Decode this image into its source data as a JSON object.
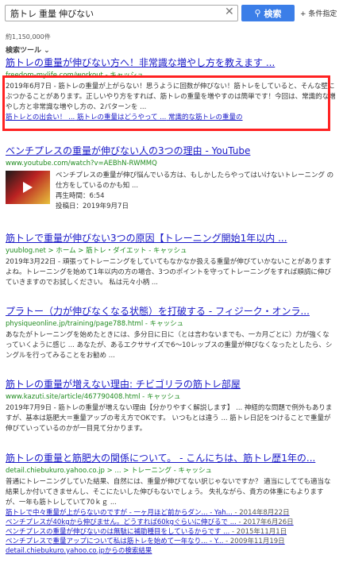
{
  "search": {
    "query": "筋トレ 重量 伸びない",
    "button_label": "検索",
    "condition_label": "+ 条件指定"
  },
  "result_count": "約1,150,000件",
  "search_tools_label": "検索ツール ⌄",
  "results": [
    {
      "title": "筋トレの重量が伸びない方へ！非常識な増やし方を教えます ...",
      "url": "freedom-mylife.com/workout - キャッシュ",
      "snippet": "2019年6月7日 - 筋トレの重量が上がらない！思うように回数が伸びない！筋トレをしていると、そんな壁にぶつかることがあります。正しいやり方をすれば、筋トレの重量を増やすのは簡単です！今回は、常識的な増やし方と非常識な増やし方の、2パターンを ...",
      "sublinks": [
        "筋トレとの出会い！ ...",
        "筋トレの重量はどうやって ...",
        "常識的な筋トレの重量の"
      ]
    },
    {
      "title": "ベンチプレスの重量が伸びない人の3つの理由 - YouTube",
      "url": "www.youtube.com/watch?v=AEBhN-RWMMQ",
      "snippet": "ベンチプレスの重量が伸び悩んでいる方は、もしかしたらやってはいけないトレーニング の仕方をしているのかも知 ...",
      "play_time": "再生時間：6:54",
      "posted": "投稿日：2019年9月7日"
    },
    {
      "title": "筋トレで重量が伸びない3つの原因【トレーニング開始1年以内 ...",
      "url": "yuublog.net > ホーム > 筋トレ・ダイエット - キャッシュ",
      "snippet": "2019年3月22日 - 頑張ってトレーニングをしていてもなかなか扱える重量が伸びていかないことがありますよね。トレーニングを始めて1年以内の方の場合、3つのポイントを守ってトレーニングをすれば順調に伸びていきますのでお試しください。 私は元々小柄 ..."
    },
    {
      "title": "プラトー（力が伸びなくなる状態）を打破する - フィジーク・オンラ...",
      "url": "physiqueonline.jp/training/page788.html - キャッシュ",
      "snippet": "あなたがトレーニングを始めたときには、多分日に日に（とは言わないまでも、一カ月ごとに）力が強くなっていくように感じ ... あなたが、あるエクササイズで6〜10レップスの重量が伸びなくなったとしたら、シングルを行ってみることをお勧め ..."
    },
    {
      "title": "筋トレの重量が増えない理由: チビゴリラの筋トレ部屋",
      "url": "www.kazuti.site/article/467790408.html - キャッシュ",
      "snippet": "2019年7月9日 - 筋トレの重量が増えない理由【分かりやすく解説します】 ... 神経的な問題で例外もありますが、基本は筋肥大＝重量アップの考え方でOKです。 いつもとは違う ... 筋トレ日記をつけることで重量が伸びていっているのかが一目見て分かります。"
    },
    {
      "title": "筋トレの重量と筋肥大の関係について。 - こんにちは、筋トレ歴1年の...",
      "url": "detail.chiebukuro.yahoo.co.jp > ... > トレーニング - キャッシュ",
      "snippet": "普通にトレーニングしていた結果、自然には、重量が伸びてない訳じゃないですか？ 適当にしてても適当な結果しか付いてきませんし、そこにたいした伸びもないでしょう。 失礼ながら、貴方の体重にもよりますが、一年も筋トレしていて70ｋｇ ...",
      "sublinks": [
        {
          "text": "筋トレで中々重量が上がらないのですが - 一ヶ月ほど前からダン... - Yah...",
          "date": " - 2014年8月22日"
        },
        {
          "text": "ベンチプレスが40kgから伸びません。どうすれば60kgぐらいに伸びるで ...",
          "date": " - 2017年6月26日"
        },
        {
          "text": "ベンチプレスの重量が伸びないのは無駄に補助種目をしているからです ...",
          "date": " - 2015年11月1日"
        },
        {
          "text": "ベンチプレスで重量アップについて私は筋トレを始めて一年なり... - Y...",
          "date": " - 2009年11月19日"
        }
      ],
      "more": "detail.chiebukuro.yahoo.co.jpからの検索結果"
    }
  ]
}
